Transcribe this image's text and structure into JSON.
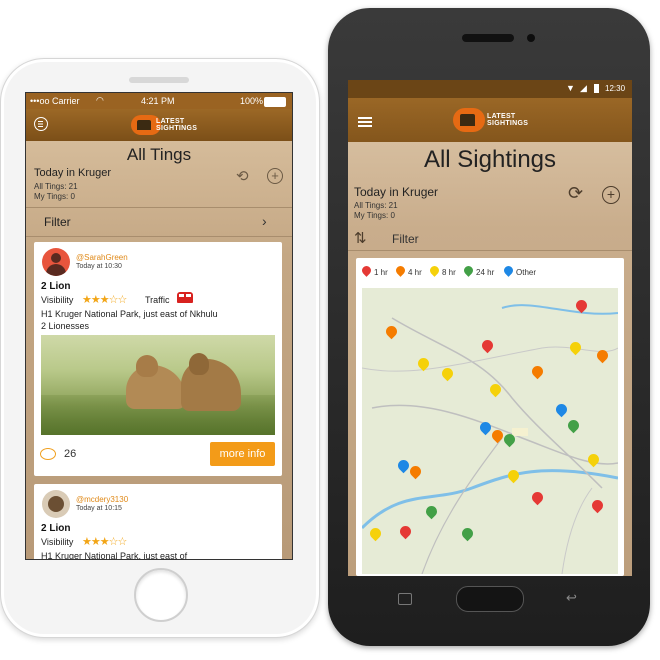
{
  "iphone": {
    "status": {
      "carrier": "•••oo Carrier",
      "time": "4:21 PM",
      "battery": "100%"
    },
    "logo": {
      "line1": "LATEST",
      "line2": "SIGHTINGS"
    },
    "title": "All Tings",
    "subtitle": "Today in Kruger",
    "all_tings": "All Tings: 21",
    "my_tings": "My Tings: 0",
    "filter_label": "Filter",
    "posts": [
      {
        "user": "@SarahGreen",
        "time": "Today at 10:30",
        "title": "2 Lion",
        "visibility_label": "Visibility",
        "visibility_stars": 3,
        "traffic_label": "Traffic",
        "location": "H1 Kruger National Park, just east of Nkhulu",
        "detail": "2 Lionesses",
        "comments": "26",
        "more_info": "more info"
      },
      {
        "user": "@mcdery3130",
        "time": "Today at 10:15",
        "title": "2 Lion",
        "visibility_label": "Visibility",
        "visibility_stars": 3,
        "location": "H1 Kruger National Park, just east of"
      }
    ]
  },
  "android": {
    "status": {
      "time": "12:30"
    },
    "logo": {
      "line1": "LATEST",
      "line2": "SIGHTINGS"
    },
    "title": "All Sightings",
    "subtitle": "Today in Kruger",
    "all_tings": "All Tings: 21",
    "my_tings": "My Tings: 0",
    "filter_label": "Filter",
    "legend": [
      {
        "label": "1 hr",
        "color": "#e53935"
      },
      {
        "label": "4 hr",
        "color": "#f57c00"
      },
      {
        "label": "8 hr",
        "color": "#f5d10a"
      },
      {
        "label": "24 hr",
        "color": "#43a047"
      },
      {
        "label": "Other",
        "color": "#1e88e5"
      }
    ]
  },
  "colors": {
    "brand": "#e66a13",
    "header": "#8a5a1e",
    "button": "#f39b18",
    "star": "#f2a516"
  }
}
